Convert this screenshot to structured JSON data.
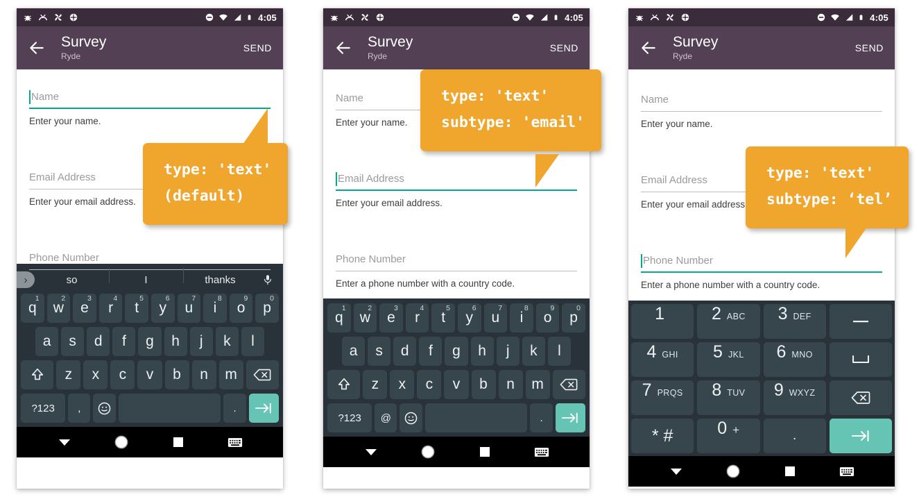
{
  "status_bar": {
    "time": "4:05",
    "left_icons": [
      "bug-icon",
      "debug-icon",
      "sync-icon",
      "settings-icon"
    ],
    "right_icons": [
      "dnd-icon",
      "wifi-icon",
      "signal-icon",
      "battery-icon"
    ]
  },
  "app_bar": {
    "back_label": "back-arrow",
    "title": "Survey",
    "subtitle": "Ryde",
    "send_label": "SEND"
  },
  "fields": {
    "name": {
      "label": "Name",
      "helper": "Enter your name."
    },
    "email": {
      "label": "Email Address",
      "helper": "Enter your email address."
    },
    "phone": {
      "label": "Phone Number",
      "helper": "Enter a phone number with a country code."
    }
  },
  "panels": [
    {
      "id": "panel-text-default",
      "active_field": "name",
      "callout": {
        "line1": "type: 'text'",
        "line2": "(default)"
      },
      "keyboard": "qwerty-suggestions"
    },
    {
      "id": "panel-text-email",
      "active_field": "email",
      "callout": {
        "line1": "type: 'text'",
        "line2": "subtype: 'email'"
      },
      "keyboard": "qwerty-email"
    },
    {
      "id": "panel-text-tel",
      "active_field": "phone",
      "callout": {
        "line1": "type: 'text'",
        "line2": "subtype: ‘tel’"
      },
      "keyboard": "numeric"
    }
  ],
  "keyboard": {
    "suggestions": [
      "so",
      "I",
      "thanks"
    ],
    "expand_icon": "chevron-right-icon",
    "mic_icon": "microphone-icon",
    "row1": [
      {
        "k": "q",
        "n": "1"
      },
      {
        "k": "w",
        "n": "2"
      },
      {
        "k": "e",
        "n": "3"
      },
      {
        "k": "r",
        "n": "4"
      },
      {
        "k": "t",
        "n": "5"
      },
      {
        "k": "y",
        "n": "6"
      },
      {
        "k": "u",
        "n": "7"
      },
      {
        "k": "i",
        "n": "8"
      },
      {
        "k": "o",
        "n": "9"
      },
      {
        "k": "p",
        "n": "0"
      }
    ],
    "row2": [
      "a",
      "s",
      "d",
      "f",
      "g",
      "h",
      "j",
      "k",
      "l"
    ],
    "row3": [
      "z",
      "x",
      "c",
      "v",
      "b",
      "n",
      "m"
    ],
    "shift_icon": "shift-icon",
    "backspace_icon": "backspace-icon",
    "symbols_label": "?123",
    "comma_label": ",",
    "at_label": "@",
    "emoji_icon": "emoji-icon",
    "space_label": "",
    "period_label": ".",
    "enter_icon": "tab-icon"
  },
  "numeric_keypad": {
    "rows": [
      [
        {
          "big": "1",
          "sub": ""
        },
        {
          "big": "2",
          "sub": "ABC"
        },
        {
          "big": "3",
          "sub": "DEF"
        },
        {
          "big": "–",
          "sub": "",
          "icon": "minus-icon"
        }
      ],
      [
        {
          "big": "4",
          "sub": "GHI"
        },
        {
          "big": "5",
          "sub": "JKL"
        },
        {
          "big": "6",
          "sub": "MNO"
        },
        {
          "big": "",
          "sub": "",
          "icon": "space-icon"
        }
      ],
      [
        {
          "big": "7",
          "sub": "PRQS"
        },
        {
          "big": "8",
          "sub": "TUV"
        },
        {
          "big": "9",
          "sub": "WXYZ"
        },
        {
          "big": "",
          "sub": "",
          "icon": "backspace-icon"
        }
      ],
      [
        {
          "big": "* #",
          "sub": ""
        },
        {
          "big": "0",
          "sub": "+"
        },
        {
          "big": ".",
          "sub": ""
        },
        {
          "big": "",
          "sub": "",
          "icon": "tab-icon"
        }
      ]
    ]
  },
  "nav_bar": {
    "items": [
      "down-arrow-icon",
      "home-circle-icon",
      "recents-square-icon",
      "keyboard-icon"
    ]
  },
  "colors": {
    "status_bar": "#3b2c3b",
    "app_bar": "#544054",
    "accent_teal": "#00a98f",
    "callout_orange": "#f0a52c",
    "keyboard_bg": "#283238",
    "key_bg": "#37454d",
    "enter_key": "#66c4b5"
  }
}
